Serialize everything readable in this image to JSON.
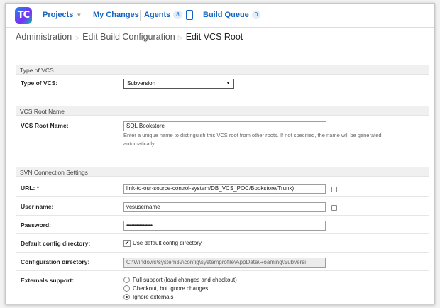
{
  "header": {
    "logo_text": "TC",
    "nav": {
      "projects": "Projects",
      "my_changes": "My Changes",
      "agents": "Agents",
      "agents_count": "8",
      "build_queue": "Build Queue",
      "build_queue_count": "0"
    }
  },
  "breadcrumb": {
    "items": [
      "Administration",
      "Edit Build Configuration",
      "Edit VCS Root"
    ]
  },
  "form": {
    "sections": {
      "type_of_vcs": "Type of VCS",
      "vcs_root_name": "VCS Root Name",
      "svn_connection": "SVN Connection Settings"
    },
    "type_of_vcs": {
      "label": "Type of VCS:",
      "value": "Subversion"
    },
    "vcs_root_name": {
      "label": "VCS Root Name:",
      "value": "SQL Bookstore",
      "note_line1": "Enter a unique name to distinguish this VCS root from other roots. If not specified, the name will be generated",
      "note_line2": "automatically."
    },
    "url": {
      "label": "URL:",
      "required_mark": "*",
      "value": "link-to-our-source-control-system/DB_VCS_POC/Bookstore/Trunk)"
    },
    "user_name": {
      "label": "User name:",
      "value": "vcsusername"
    },
    "password": {
      "label": "Password:",
      "value": "••••••••••••••••••••"
    },
    "default_config": {
      "label": "Default config directory:",
      "checkbox_label": "Use default config directory",
      "checked": true
    },
    "config_dir": {
      "label": "Configuration directory:",
      "value": "C:\\Windows\\system32\\config\\systemprofile\\AppData\\Roaming\\Subversi"
    },
    "externals": {
      "label": "Externals support:",
      "options": [
        "Full support (load changes and checkout)",
        "Checkout, but ignore changes",
        "Ignore externals"
      ],
      "selected_index": 2
    }
  }
}
